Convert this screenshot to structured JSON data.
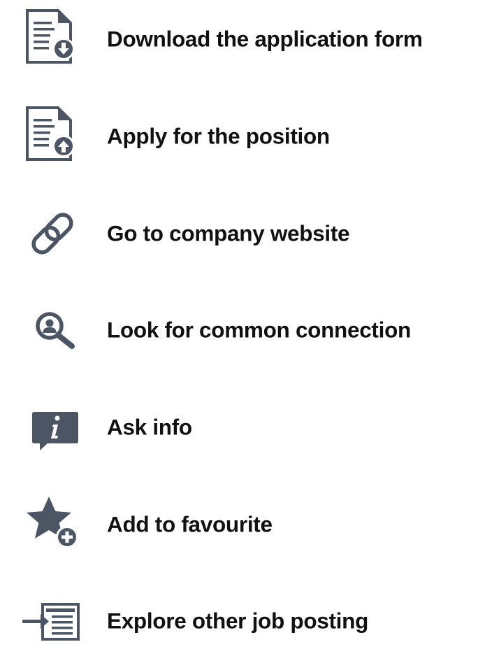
{
  "actions": [
    {
      "id": "download-form",
      "label": "Download the application form",
      "icon": "document-download-icon"
    },
    {
      "id": "apply",
      "label": "Apply for the position",
      "icon": "document-upload-icon"
    },
    {
      "id": "company-website",
      "label": "Go to company website",
      "icon": "link-icon"
    },
    {
      "id": "common-connection",
      "label": "Look for common connection",
      "icon": "person-search-icon"
    },
    {
      "id": "ask-info",
      "label": "Ask info",
      "icon": "info-chat-icon"
    },
    {
      "id": "add-favourite",
      "label": "Add to favourite",
      "icon": "star-add-icon"
    },
    {
      "id": "explore-postings",
      "label": "Explore other job posting",
      "icon": "enter-list-icon"
    }
  ],
  "colors": {
    "icon": "#4b5563",
    "text": "#111111",
    "background": "#ffffff"
  }
}
